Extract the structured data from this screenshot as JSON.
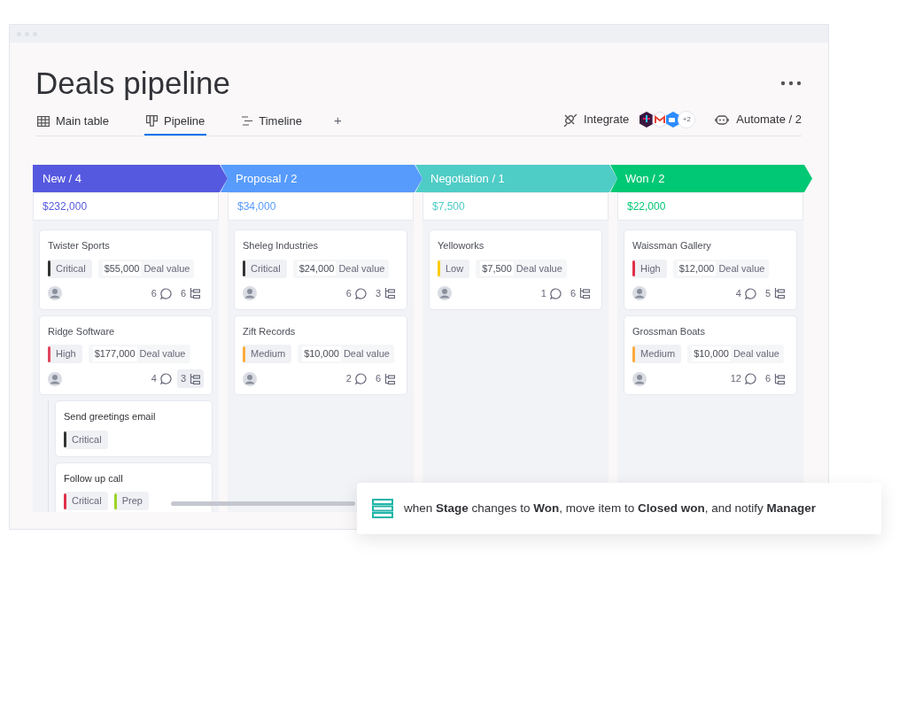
{
  "title": "Deals pipeline",
  "tabs": [
    {
      "label": "Main table",
      "kind": "table",
      "selected": false
    },
    {
      "label": "Pipeline",
      "kind": "pipeline",
      "selected": true
    },
    {
      "label": "Timeline",
      "kind": "timeline",
      "selected": false
    }
  ],
  "add_tab": "+",
  "integrate": {
    "label": "Integrate",
    "more_apps": "+2"
  },
  "automate": {
    "label": "Automate / 2"
  },
  "columns": [
    {
      "title": "New / 4",
      "color": "#5559df",
      "total": "$232,000",
      "cards": [
        {
          "name": "Twister Sports",
          "tags": [
            {
              "label": "Critical",
              "color": "#333333"
            }
          ],
          "amount": "$55,000",
          "amount_label": "Deal value",
          "comments": "6",
          "subitems": "6",
          "expanded": false
        },
        {
          "name": "Ridge Software",
          "tags": [
            {
              "label": "High",
              "color": "#e2445c"
            }
          ],
          "amount": "$177,000",
          "amount_label": "Deal value",
          "comments": "4",
          "subitems": "3",
          "expanded": true,
          "children": [
            {
              "name": "Send greetings email",
              "tags": [
                {
                  "label": "Critical",
                  "color": "#333333"
                }
              ]
            },
            {
              "name": "Follow up call",
              "tags": [
                {
                  "label": "Critical",
                  "color": "#df2f4a"
                },
                {
                  "label": "Prep",
                  "color": "#9cd326"
                }
              ]
            }
          ]
        }
      ]
    },
    {
      "title": "Proposal / 2",
      "color": "#579bfc",
      "total": "$34,000",
      "cards": [
        {
          "name": "Sheleg Industries",
          "tags": [
            {
              "label": "Critical",
              "color": "#333333"
            }
          ],
          "amount": "$24,000",
          "amount_label": "Deal value",
          "comments": "6",
          "subitems": "3",
          "expanded": false
        },
        {
          "name": "Zift Records",
          "tags": [
            {
              "label": "Medium",
              "color": "#fdab3d"
            }
          ],
          "amount": "$10,000",
          "amount_label": "Deal value",
          "comments": "2",
          "subitems": "6",
          "expanded": false
        }
      ]
    },
    {
      "title": "Negotiation / 1",
      "color": "#4eccc6",
      "total": "$7,500",
      "cards": [
        {
          "name": "Yelloworks",
          "tags": [
            {
              "label": "Low",
              "color": "#ffcb00"
            }
          ],
          "amount": "$7,500",
          "amount_label": "Deal value",
          "comments": "1",
          "subitems": "6",
          "expanded": false
        }
      ]
    },
    {
      "title": "Won / 2",
      "color": "#00c875",
      "total": "$22,000",
      "cards": [
        {
          "name": "Waissman Gallery",
          "tags": [
            {
              "label": "High",
              "color": "#df2f4a"
            }
          ],
          "amount": "$12,000",
          "amount_label": "Deal value",
          "comments": "4",
          "subitems": "5",
          "expanded": false
        },
        {
          "name": "Grossman Boats",
          "tags": [
            {
              "label": "Medium",
              "color": "#fdab3d"
            }
          ],
          "amount": "$10,000",
          "amount_label": "Deal value",
          "comments": "12",
          "subitems": "6",
          "expanded": false
        }
      ]
    }
  ],
  "automation": "when **Stage** changes to **Won**, move item to **Closed won**, and notify **Manager**"
}
